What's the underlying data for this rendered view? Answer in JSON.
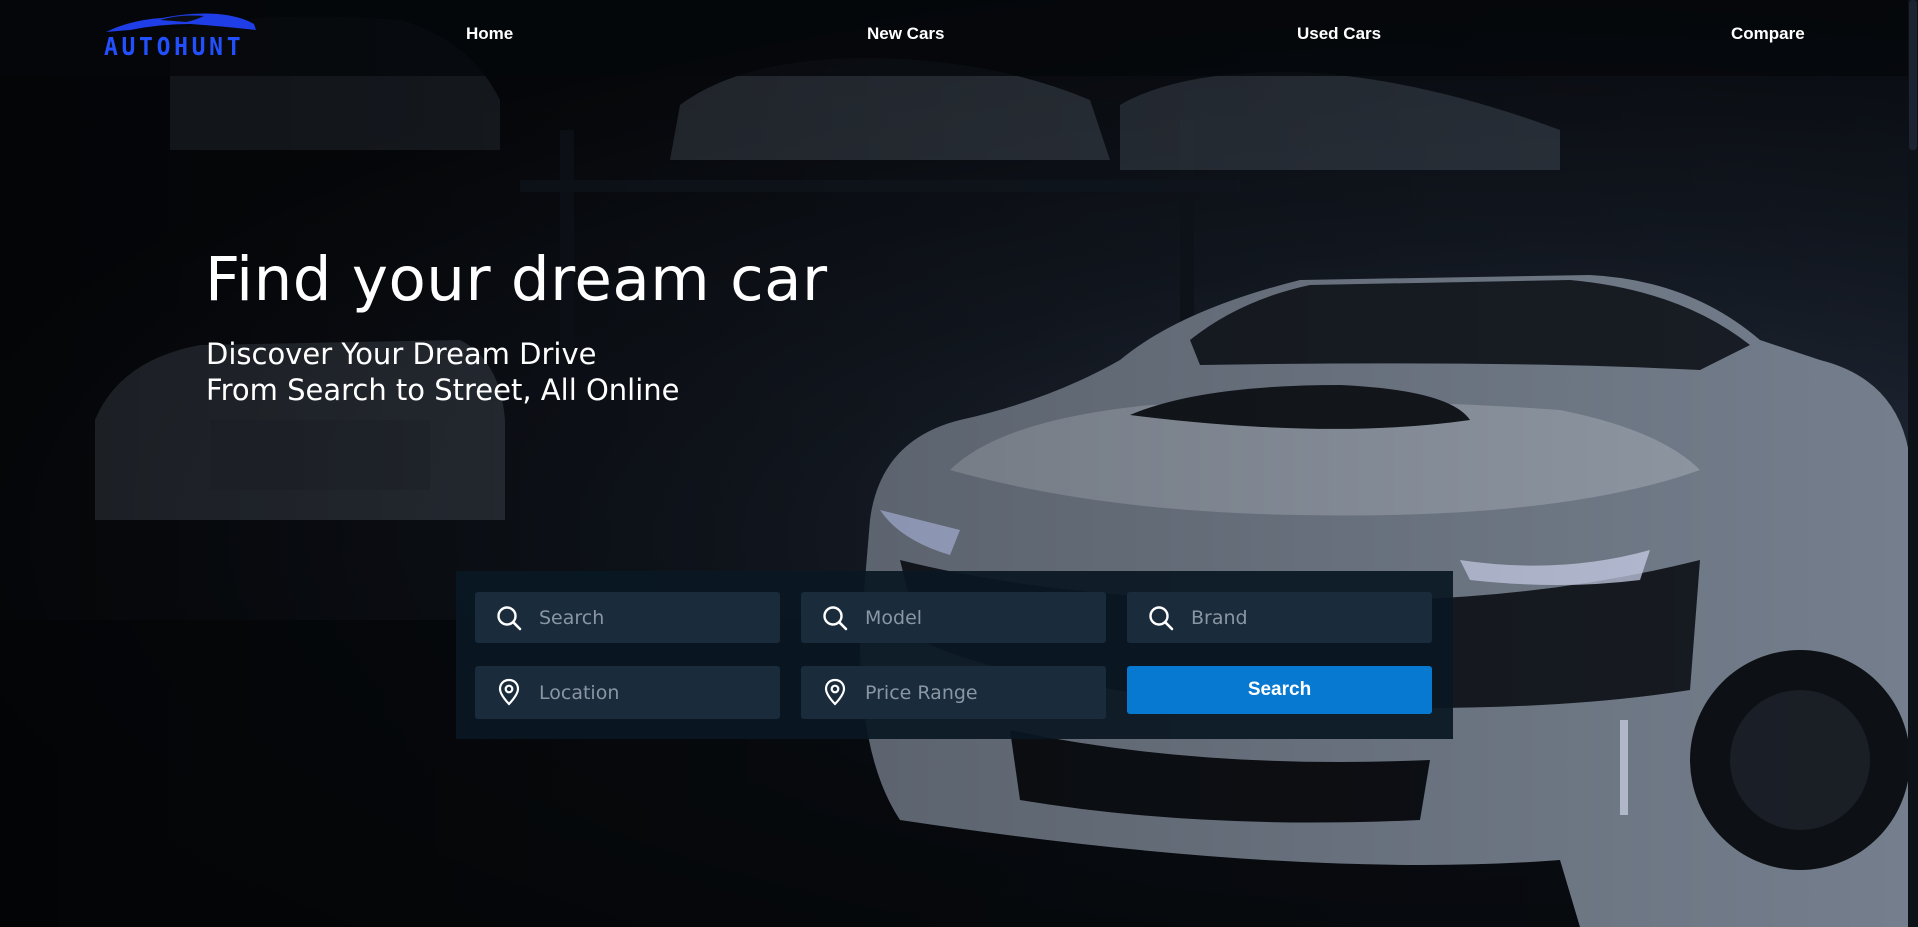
{
  "brand": {
    "logo_text": "AUTOHUNT",
    "logo_color": "#2350ff"
  },
  "nav": {
    "items": [
      {
        "label": "Home"
      },
      {
        "label": "New Cars"
      },
      {
        "label": "Used Cars"
      },
      {
        "label": "Compare"
      }
    ]
  },
  "hero": {
    "title": "Find your dream car",
    "subtitle_line1": "Discover Your Dream Drive",
    "subtitle_line2": "From Search to Street, All Online"
  },
  "search_panel": {
    "search_placeholder": "Search",
    "model_placeholder": "Model",
    "brand_placeholder": "Brand",
    "location_placeholder": "Location",
    "price_placeholder": "Price Range",
    "button_label": "Search",
    "button_color": "#0779d1",
    "field_color": "#1a2b3c"
  },
  "icons": {
    "search_fields": "search-icon",
    "location_fields": "map-pin-icon"
  }
}
